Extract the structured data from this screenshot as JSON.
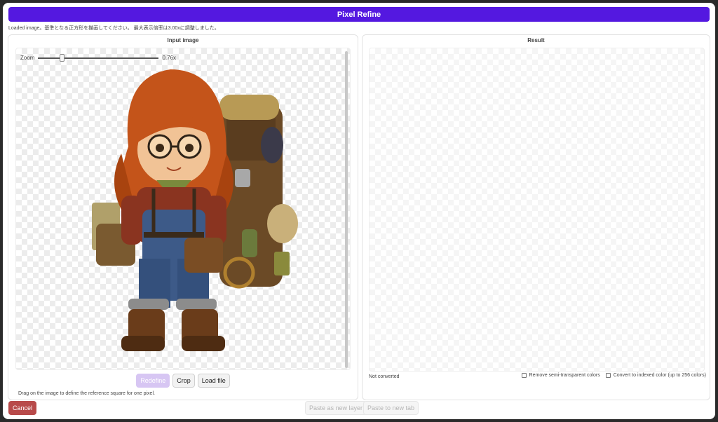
{
  "app": {
    "title": "Pixel Refine",
    "status_message": "Loaded image。基準となる正方形を描画してください。 最大表示倍率は3.00xに調整しました。"
  },
  "input_panel": {
    "title": "Input image",
    "zoom_label": "Zoom",
    "zoom_value": "0.76x",
    "zoom_fraction": 0.19,
    "buttons": {
      "redefine": "Redefine",
      "crop": "Crop",
      "load_file": "Load file"
    },
    "hint": "Drag on the image to define the reference square for one pixel."
  },
  "result_panel": {
    "title": "Result",
    "status": "Not converted",
    "options": {
      "remove_semi_transparent": "Remove semi-transparent colors",
      "remove_semi_transparent_checked": false,
      "convert_indexed": "Convert to indexed color (up to 256 colors)",
      "convert_indexed_checked": false
    }
  },
  "footer": {
    "cancel": "Cancel",
    "paste_as_layer": "Paste as new layer",
    "paste_new_tab": "Paste to new tab"
  },
  "colors": {
    "accent": "#5418e0",
    "cancel": "#b84a4a"
  }
}
